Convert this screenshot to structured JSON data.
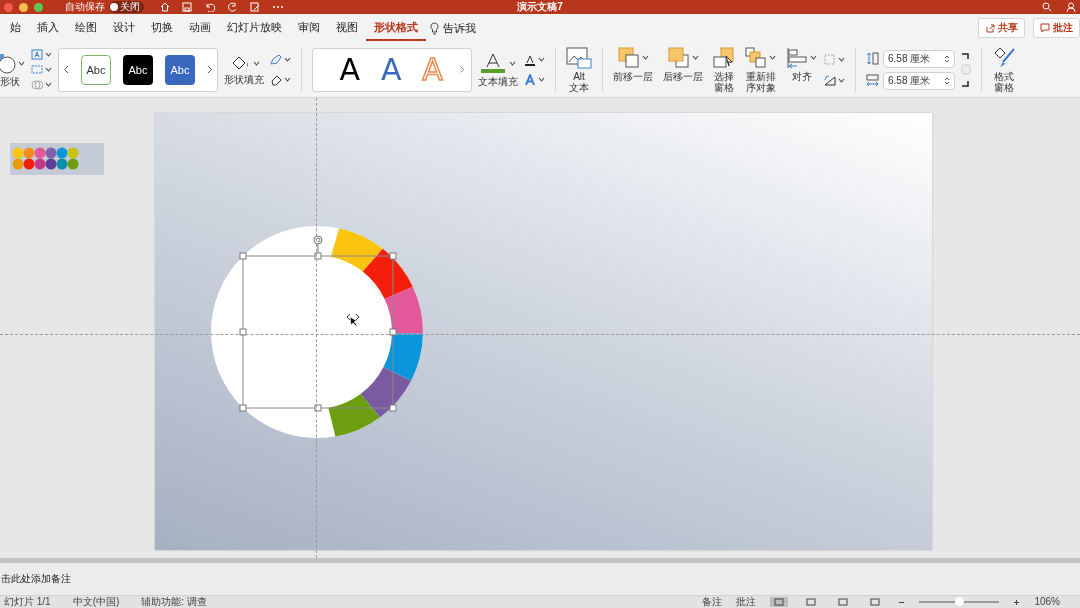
{
  "window": {
    "autosave_label": "自动保存",
    "autosave": {
      "on": false,
      "label": "关闭"
    },
    "title": "演示文稿7"
  },
  "tabs": [
    {
      "label": "始",
      "selected": false
    },
    {
      "label": "插入",
      "selected": false
    },
    {
      "label": "绘图",
      "selected": false
    },
    {
      "label": "设计",
      "selected": false
    },
    {
      "label": "切换",
      "selected": false
    },
    {
      "label": "动画",
      "selected": false
    },
    {
      "label": "幻灯片放映",
      "selected": false
    },
    {
      "label": "审阅",
      "selected": false
    },
    {
      "label": "视图",
      "selected": false
    },
    {
      "label": "形状格式",
      "selected": true
    }
  ],
  "tell_me": "告诉我",
  "share_button": "共享",
  "comments_button": "批注",
  "ribbon": {
    "shapes_label": "形状",
    "shape_styles": [
      {
        "label": "Abc",
        "kind": "outline"
      },
      {
        "label": "Abc",
        "kind": "dark"
      },
      {
        "label": "Abc",
        "kind": "blue"
      }
    ],
    "shape_fill": "形状填充",
    "wordart_styles": [
      {
        "label": "A",
        "kind": "black"
      },
      {
        "label": "A",
        "kind": "blue"
      },
      {
        "label": "A",
        "kind": "orange"
      }
    ],
    "text_fill": "文本填充",
    "alt_text": "Alt\n文本",
    "arrange": [
      {
        "label": "前移一层",
        "kind": "forward"
      },
      {
        "label": "后移一层",
        "kind": "backward"
      },
      {
        "label": "选择窗格",
        "kind": "pane"
      },
      {
        "label": "重新排序对象",
        "kind": "reorder"
      },
      {
        "label": "对齐",
        "kind": "align"
      }
    ],
    "height": "6.58 厘米",
    "width": "6.58 厘米",
    "format_pane": "格式窗格"
  },
  "slide": {
    "ring_segments": [
      {
        "color": "#fbc40e"
      },
      {
        "color": "#f41f0a"
      },
      {
        "color": "#e2589a"
      },
      {
        "color": "#0b96dc"
      },
      {
        "color": "#7a5ba1"
      },
      {
        "color": "#6d9e10"
      }
    ]
  },
  "notes": {
    "placeholder": "击此处添加备注"
  },
  "status_bar": {
    "left": [
      "幻灯片 1/1",
      "中文(中国)",
      "辅助功能: 调查"
    ],
    "notes_button": "备注",
    "comments_button": "批注",
    "views": [
      {
        "selected": true
      },
      {
        "selected": false
      },
      {
        "selected": false
      },
      {
        "selected": false
      }
    ],
    "zoom": {
      "level": 0.5,
      "label": "106%"
    }
  }
}
